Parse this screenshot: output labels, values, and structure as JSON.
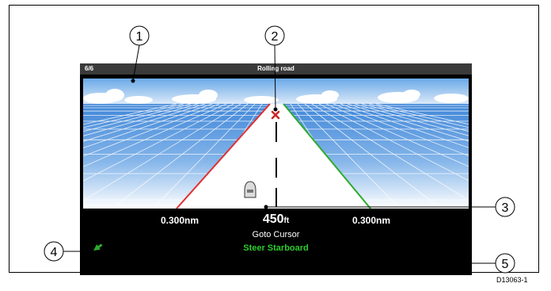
{
  "screen": {
    "page_indicator": "6/6",
    "title": "Rolling road"
  },
  "readout": {
    "left_distance": "0.300nm",
    "right_distance": "0.300nm",
    "xte_value": "450",
    "xte_unit": "ft",
    "mode": "Goto Cursor",
    "steer": "Steer Starboard"
  },
  "callouts": [
    "1",
    "2",
    "3",
    "4",
    "5"
  ],
  "figure_code": "D13063-1",
  "colors": {
    "left_lane": "#e03030",
    "right_lane": "#2eaa2e",
    "steer_text": "#2ecc2e",
    "target_marker": "#cc2a2a"
  },
  "icons": {
    "target": "target-x-icon",
    "vessel": "boat-icon",
    "wind": "arrow-icon"
  }
}
